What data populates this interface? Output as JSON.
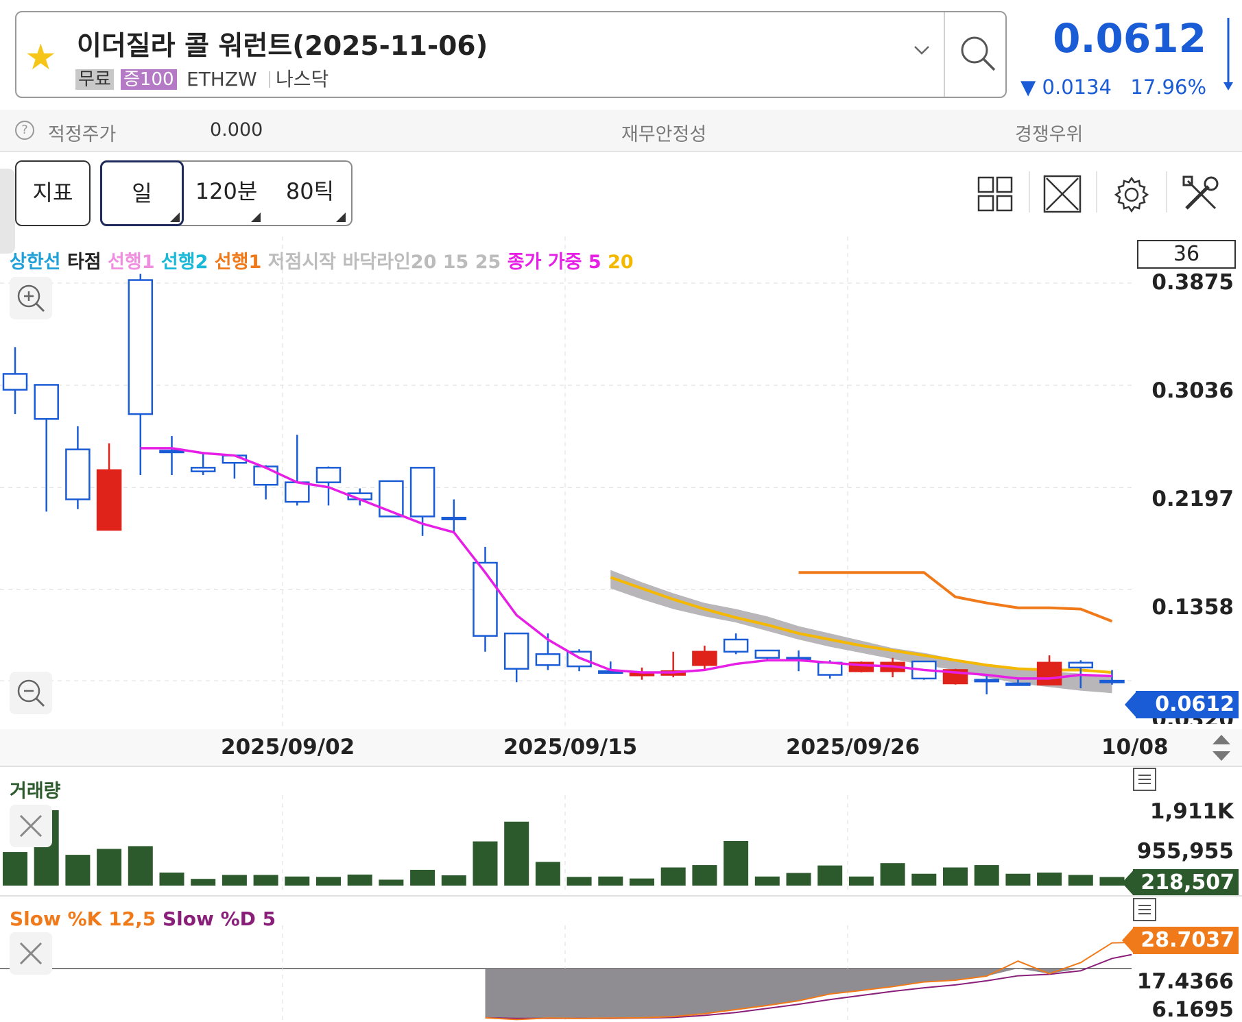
{
  "header": {
    "title": "이더질라 콜 워런트(2025-11-06)",
    "tag_free": "무료",
    "tag_margin": "증100",
    "ticker": "ETHZW",
    "market": "나스닥",
    "price": "0.0612",
    "change": "0.0134",
    "change_pct": "17.96%",
    "change_direction": "down",
    "accent_color": "#1a5bd6"
  },
  "valuation": {
    "fair_price_label": "적정주가",
    "fair_price_value": "0.000",
    "financial_stability_label": "재무안정성",
    "competitive_edge_label": "경쟁우위"
  },
  "toolbar": {
    "indicator_label": "지표",
    "period_day": "일",
    "period_120min": "120분",
    "period_80tick": "80틱",
    "icons": [
      "grid-layout-icon",
      "expand-icon",
      "gear-icon",
      "tools-icon"
    ]
  },
  "legend": {
    "upper_limit": "상한선",
    "hit_point": "타점",
    "lead1_a": "선행1",
    "lead2": "선행2",
    "lead1_b": "선행1",
    "low_start": "저점시작",
    "bottom_line": "바닥라인20 15 25",
    "close_weighted": "종가 가중 5",
    "ma20": "20",
    "count": "36"
  },
  "price_axis": [
    "0.3875",
    "0.3036",
    "0.2197",
    "0.1358",
    "0.0320"
  ],
  "current_price_tag": "0.0612",
  "dates": [
    "2025/09/02",
    "2025/09/15",
    "2025/09/26",
    "10/08"
  ],
  "chart_data": {
    "type": "candlestick",
    "ylim": [
      0.032,
      0.3875
    ],
    "candles": [
      {
        "o": 0.313,
        "h": 0.335,
        "l": 0.28,
        "c": 0.3,
        "up": false
      },
      {
        "o": 0.276,
        "h": 0.289,
        "l": 0.2,
        "c": 0.304,
        "up": false
      },
      {
        "o": 0.21,
        "h": 0.27,
        "l": 0.202,
        "c": 0.251,
        "up": false
      },
      {
        "o": 0.185,
        "h": 0.256,
        "l": 0.185,
        "c": 0.234,
        "up": true
      },
      {
        "o": 0.28,
        "h": 0.395,
        "l": 0.23,
        "c": 0.39,
        "up": false
      },
      {
        "o": 0.25,
        "h": 0.262,
        "l": 0.23,
        "c": 0.25,
        "up": false
      },
      {
        "o": 0.233,
        "h": 0.248,
        "l": 0.23,
        "c": 0.236,
        "up": false
      },
      {
        "o": 0.24,
        "h": 0.243,
        "l": 0.227,
        "c": 0.246,
        "up": false
      },
      {
        "o": 0.222,
        "h": 0.238,
        "l": 0.21,
        "c": 0.237,
        "up": false
      },
      {
        "o": 0.208,
        "h": 0.263,
        "l": 0.205,
        "c": 0.224,
        "up": false
      },
      {
        "o": 0.224,
        "h": 0.237,
        "l": 0.205,
        "c": 0.236,
        "up": false
      },
      {
        "o": 0.21,
        "h": 0.219,
        "l": 0.205,
        "c": 0.215,
        "up": false
      },
      {
        "o": 0.196,
        "h": 0.225,
        "l": 0.196,
        "c": 0.225,
        "up": false
      },
      {
        "o": 0.196,
        "h": 0.236,
        "l": 0.18,
        "c": 0.236,
        "up": false
      },
      {
        "o": 0.194,
        "h": 0.21,
        "l": 0.183,
        "c": 0.195,
        "up": false
      },
      {
        "o": 0.098,
        "h": 0.171,
        "l": 0.085,
        "c": 0.158,
        "up": false
      },
      {
        "o": 0.071,
        "h": 0.1,
        "l": 0.06,
        "c": 0.1,
        "up": false
      },
      {
        "o": 0.074,
        "h": 0.1,
        "l": 0.07,
        "c": 0.083,
        "up": false
      },
      {
        "o": 0.073,
        "h": 0.087,
        "l": 0.069,
        "c": 0.085,
        "up": false
      },
      {
        "o": 0.069,
        "h": 0.077,
        "l": 0.068,
        "c": 0.069,
        "up": false
      },
      {
        "o": 0.066,
        "h": 0.072,
        "l": 0.062,
        "c": 0.067,
        "up": true
      },
      {
        "o": 0.069,
        "h": 0.085,
        "l": 0.064,
        "c": 0.066,
        "up": true
      },
      {
        "o": 0.074,
        "h": 0.09,
        "l": 0.07,
        "c": 0.085,
        "up": true
      },
      {
        "o": 0.085,
        "h": 0.1,
        "l": 0.083,
        "c": 0.095,
        "up": false
      },
      {
        "o": 0.08,
        "h": 0.086,
        "l": 0.077,
        "c": 0.086,
        "up": false
      },
      {
        "o": 0.08,
        "h": 0.086,
        "l": 0.069,
        "c": 0.08,
        "up": false
      },
      {
        "o": 0.066,
        "h": 0.078,
        "l": 0.063,
        "c": 0.076,
        "up": false
      },
      {
        "o": 0.069,
        "h": 0.077,
        "l": 0.068,
        "c": 0.076,
        "up": true
      },
      {
        "o": 0.069,
        "h": 0.08,
        "l": 0.064,
        "c": 0.076,
        "up": true
      },
      {
        "o": 0.063,
        "h": 0.077,
        "l": 0.062,
        "c": 0.077,
        "up": false
      },
      {
        "o": 0.059,
        "h": 0.071,
        "l": 0.058,
        "c": 0.07,
        "up": true
      },
      {
        "o": 0.062,
        "h": 0.065,
        "l": 0.05,
        "c": 0.062,
        "up": false
      },
      {
        "o": 0.059,
        "h": 0.063,
        "l": 0.057,
        "c": 0.059,
        "up": false
      },
      {
        "o": 0.058,
        "h": 0.082,
        "l": 0.058,
        "c": 0.076,
        "up": true
      },
      {
        "o": 0.072,
        "h": 0.078,
        "l": 0.055,
        "c": 0.076,
        "up": false
      },
      {
        "o": 0.0612,
        "h": 0.07,
        "l": 0.058,
        "c": 0.0612,
        "up": false
      }
    ],
    "close_weighted_ma": [
      null,
      null,
      null,
      null,
      0.252,
      0.252,
      0.248,
      0.246,
      0.236,
      0.224,
      0.22,
      0.21,
      0.2,
      0.19,
      0.183,
      0.15,
      0.115,
      0.095,
      0.08,
      0.07,
      0.068,
      0.068,
      0.07,
      0.075,
      0.078,
      0.078,
      0.076,
      0.074,
      0.073,
      0.07,
      0.068,
      0.066,
      0.063,
      0.063,
      0.066,
      0.065
    ],
    "ma20": [
      null,
      null,
      null,
      null,
      null,
      null,
      null,
      null,
      null,
      null,
      null,
      null,
      null,
      null,
      null,
      null,
      null,
      null,
      null,
      0.146,
      0.137,
      0.128,
      0.12,
      0.113,
      0.107,
      0.1,
      0.095,
      0.09,
      0.086,
      0.082,
      0.078,
      0.074,
      0.071,
      0.07,
      0.07,
      0.068
    ],
    "lead1": [
      null,
      null,
      null,
      null,
      null,
      null,
      null,
      null,
      null,
      null,
      null,
      null,
      null,
      null,
      null,
      null,
      null,
      null,
      null,
      null,
      null,
      null,
      null,
      null,
      null,
      0.15,
      0.15,
      0.15,
      0.15,
      0.15,
      0.13,
      0.125,
      0.121,
      0.121,
      0.12,
      0.11
    ],
    "cloud_top": [
      null,
      null,
      null,
      null,
      null,
      null,
      null,
      null,
      null,
      null,
      null,
      null,
      null,
      null,
      null,
      null,
      null,
      null,
      null,
      0.152,
      0.142,
      0.133,
      0.125,
      0.12,
      0.114,
      0.106,
      0.1,
      0.094,
      0.088,
      0.084,
      0.079,
      0.075,
      0.072,
      0.069,
      0.067,
      0.065
    ],
    "cloud_bot": [
      null,
      null,
      null,
      null,
      null,
      null,
      null,
      null,
      null,
      null,
      null,
      null,
      null,
      null,
      null,
      null,
      null,
      null,
      null,
      0.137,
      0.128,
      0.12,
      0.114,
      0.109,
      0.102,
      0.095,
      0.089,
      0.084,
      0.079,
      0.074,
      0.07,
      0.064,
      0.059,
      0.056,
      0.053,
      0.051
    ]
  },
  "volume": {
    "title": "거래량",
    "axis": [
      "1,911K",
      "955,955"
    ],
    "current_tag": "218,507",
    "bar_color": "#2c5a2c",
    "values": [
      850,
      1911,
      780,
      930,
      1000,
      330,
      170,
      270,
      270,
      230,
      220,
      280,
      150,
      400,
      260,
      1120,
      1620,
      600,
      220,
      230,
      180,
      460,
      520,
      1130,
      230,
      320,
      510,
      230,
      570,
      300,
      460,
      520,
      300,
      330,
      270,
      218
    ]
  },
  "stoch": {
    "title_k": "Slow %K 12,5",
    "title_d": "Slow %D 5",
    "axis": [
      "17.4366",
      "6.1695"
    ],
    "current_tag": "28.7037",
    "k_color": "#f07a1a",
    "d_color": "#8a1f7a",
    "k": [
      null,
      null,
      null,
      null,
      null,
      null,
      null,
      null,
      null,
      null,
      null,
      null,
      null,
      null,
      null,
      3.2,
      2.6,
      3.1,
      3.0,
      3.1,
      3.2,
      3.6,
      4.6,
      6.0,
      7.4,
      9.0,
      11.3,
      12.5,
      13.8,
      15.4,
      16.0,
      17.4,
      22.5,
      18.2,
      22.0,
      28.7,
      28.9
    ],
    "d": [
      null,
      null,
      null,
      null,
      null,
      null,
      null,
      null,
      null,
      null,
      null,
      null,
      null,
      null,
      null,
      3.2,
      3.0,
      3.0,
      3.0,
      3.0,
      3.1,
      3.3,
      4.0,
      5.0,
      6.4,
      7.8,
      9.4,
      10.8,
      12.2,
      13.4,
      14.4,
      15.8,
      17.5,
      18.0,
      19.2,
      23.4,
      25.5
    ]
  }
}
